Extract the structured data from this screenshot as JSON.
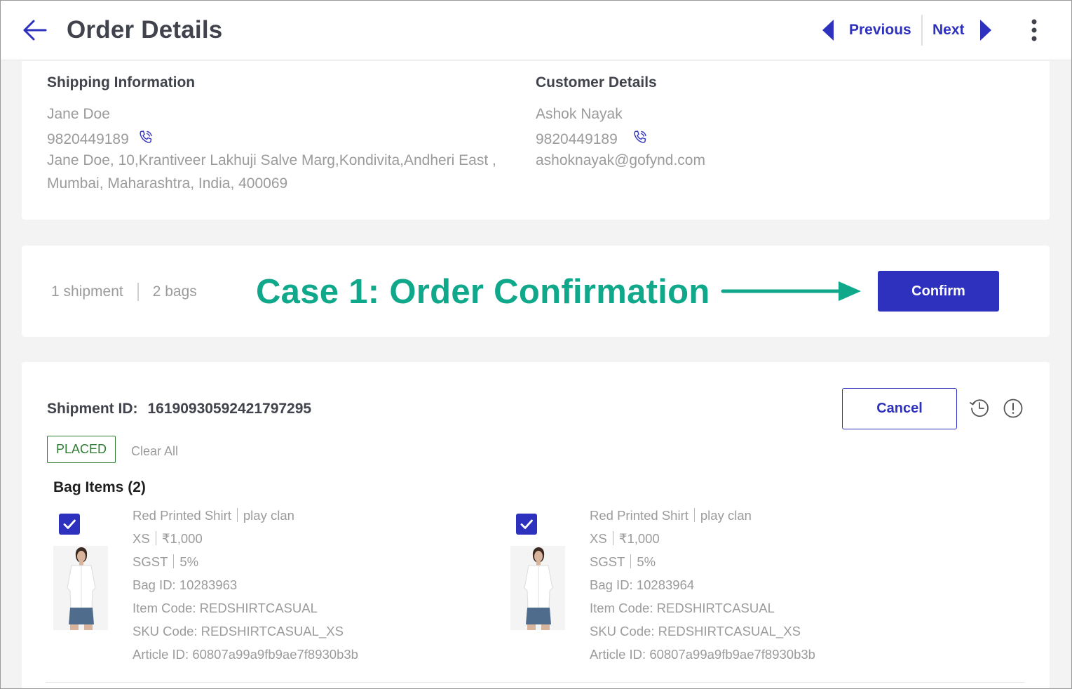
{
  "header": {
    "title": "Order Details",
    "previous_label": "Previous",
    "next_label": "Next"
  },
  "shipping": {
    "heading": "Shipping Information",
    "name": "Jane Doe",
    "phone": "9820449189",
    "address_line1": "Jane Doe, 10,Krantiveer Lakhuji Salve Marg,Kondivita,Andheri East ,",
    "address_line2": "Mumbai, Maharashtra, India, 400069"
  },
  "customer": {
    "heading": "Customer Details",
    "name": "Ashok Nayak",
    "phone": "9820449189",
    "email": "ashoknayak@gofynd.com"
  },
  "summary": {
    "shipments": "1 shipment",
    "bags": "2 bags",
    "annotation": "Case 1: Order Confirmation",
    "confirm_label": "Confirm"
  },
  "shipment": {
    "id_label": "Shipment ID:",
    "id_value": "16190930592421797295",
    "cancel_label": "Cancel",
    "status": "PLACED",
    "clear_all": "Clear All",
    "bag_items_title": "Bag Items (2)",
    "items": [
      {
        "name": "Red Printed Shirt",
        "brand": "play clan",
        "size": "XS",
        "price": "₹1,000",
        "tax_name": "SGST",
        "tax_rate": "5%",
        "bag_id": "Bag ID: 10283963",
        "item_code": "Item Code: REDSHIRTCASUAL",
        "sku_code": "SKU Code: REDSHIRTCASUAL_XS",
        "article_id": "Article ID: 60807a99a9fb9ae7f8930b3b",
        "checked": true
      },
      {
        "name": "Red Printed Shirt",
        "brand": "play clan",
        "size": "XS",
        "price": "₹1,000",
        "tax_name": "SGST",
        "tax_rate": "5%",
        "bag_id": "Bag ID: 10283964",
        "item_code": "Item Code: REDSHIRTCASUAL",
        "sku_code": "SKU Code: REDSHIRTCASUAL_XS",
        "article_id": "Article ID: 60807a99a9fb9ae7f8930b3b",
        "checked": true
      }
    ]
  },
  "colors": {
    "accent": "#2e31be",
    "annotation": "#0fa88a",
    "status_green": "#2e7d32"
  },
  "icons": {
    "back": "arrow-left-icon",
    "previous": "triangle-left-icon",
    "next": "triangle-right-icon",
    "more": "kebab-menu-icon",
    "phone": "phone-call-icon",
    "history": "history-icon",
    "info": "alert-circle-icon",
    "check": "checkmark-icon"
  }
}
